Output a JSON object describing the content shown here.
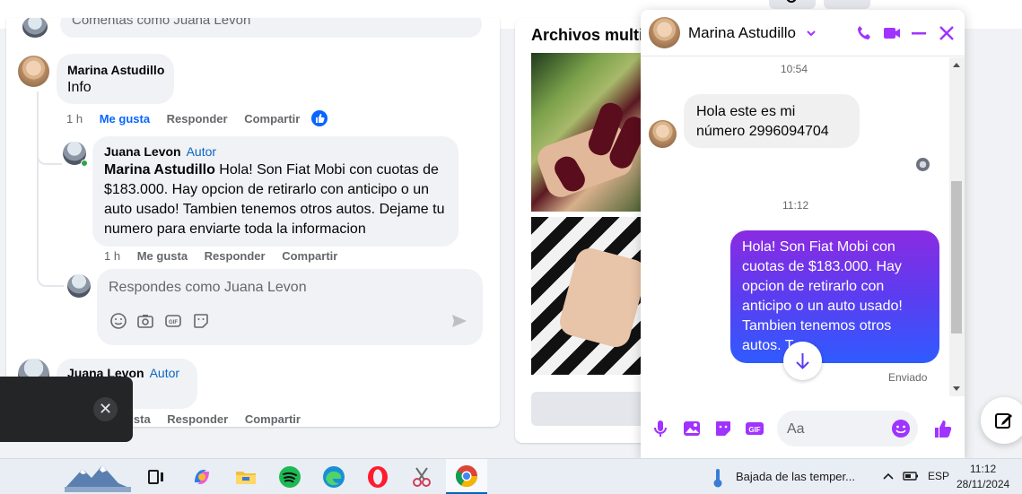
{
  "feed": {
    "top_input_placeholder": "Comentas como Juana Levon",
    "comment1": {
      "author": "Marina Astudillo",
      "text": "Info",
      "time": "1 h",
      "like": "Me gusta",
      "reply": "Responder",
      "share": "Compartir"
    },
    "reply1": {
      "author": "Juana Levon",
      "badge": "Autor",
      "mention": "Marina Astudillo",
      "text": " Hola! Son Fiat Mobi con cuotas de $183.000. Hay opcion de retirarlo con anticipo o un auto usado! Tambien tenemos otros autos. Dejame tu numero para enviarte toda la informacion",
      "time": "1 h",
      "like": "Me gusta",
      "reply": "Responder",
      "share": "Compartir"
    },
    "reply_box": {
      "placeholder": "Respondes como Juana Levon"
    },
    "comment2": {
      "author": "Juana Levon",
      "badge": "Autor",
      "like": "gusta",
      "reply": "Responder",
      "share": "Compartir"
    }
  },
  "media": {
    "title": "Archivos multimedia"
  },
  "chat": {
    "contact_name": "Marina Astudillo",
    "time1": "10:54",
    "incoming_message": "Hola este es mi número 2996094704",
    "time2": "11:12",
    "outgoing_message": "Hola! Son Fiat Mobi con cuotas de $183.000. Hay opcion de retirarlo con anticipo o un auto usado! Tambien tenemos otros autos. T",
    "status": "Enviado",
    "composer_placeholder": "Aa",
    "icons": [
      "phone-icon",
      "video-icon",
      "minimize-icon",
      "close-icon",
      "microphone-icon",
      "photo-icon",
      "sticker-icon",
      "gif-icon",
      "emoji-icon",
      "thumbs-up-icon"
    ]
  },
  "toast": {
    "close_symbol": "✕"
  },
  "taskbar": {
    "weather": "Bajada de las temper...",
    "language": "ESP",
    "time": "11:12",
    "date": "28/11/2024",
    "apps": [
      "landscape-widget",
      "task-view",
      "copilot",
      "file-explorer",
      "spotify",
      "edge",
      "opera",
      "snipping-tool",
      "chrome"
    ]
  },
  "colors": {
    "facebook_blue": "#0866ff",
    "messenger_purple": "#a033ff",
    "gradient_start": "#8a2be2",
    "gradient_end": "#2f5bff"
  }
}
